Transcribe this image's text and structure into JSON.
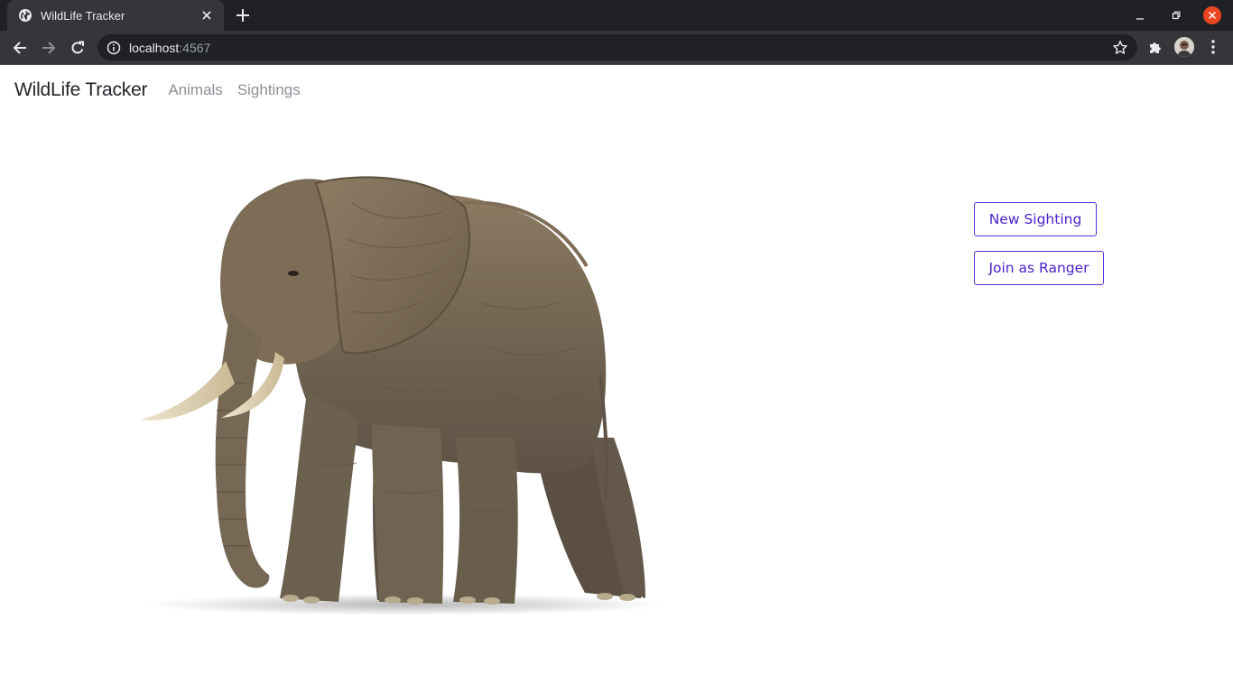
{
  "browser": {
    "tab_title": "WildLife Tracker",
    "url_host": "localhost",
    "url_port": ":4567",
    "icons": [
      "globe-icon",
      "close-icon",
      "plus-icon",
      "minimize-icon",
      "restore-icon",
      "window-close-icon",
      "back-arrow-icon",
      "forward-arrow-icon",
      "reload-icon",
      "info-icon",
      "star-icon",
      "puzzle-icon",
      "kebab-menu-icon"
    ],
    "colors": {
      "tabstrip": "#202124",
      "toolbar": "#35363a",
      "close_button": "#e9451f"
    }
  },
  "navbar": {
    "brand": "WildLife Tracker",
    "links": [
      "Animals",
      "Sightings"
    ]
  },
  "hero": {
    "image_subject": "elephant"
  },
  "actions": {
    "new_sighting": "New Sighting",
    "join_ranger": "Join as Ranger",
    "accent_color": "#5b2bd6"
  }
}
